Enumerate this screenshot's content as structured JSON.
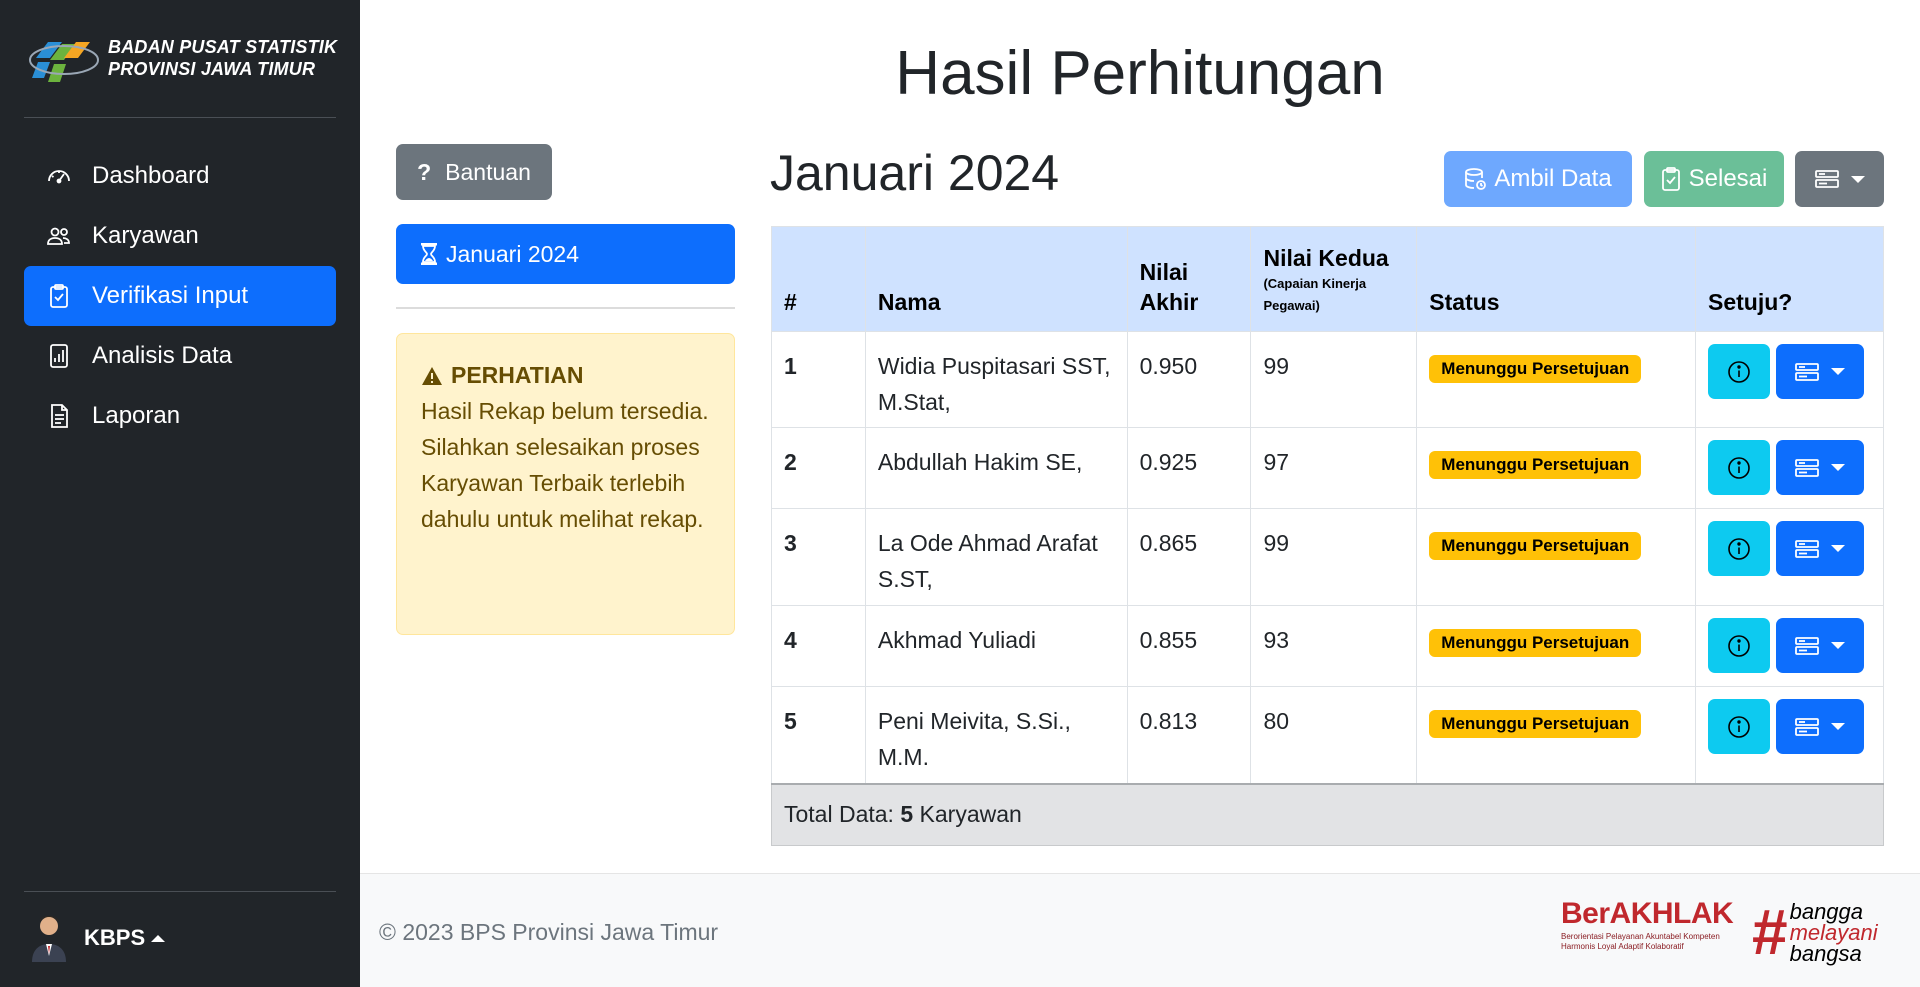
{
  "brand": {
    "line1": "BADAN PUSAT STATISTIK",
    "line2": "PROVINSI JAWA TIMUR"
  },
  "nav": [
    {
      "label": "Dashboard",
      "icon": "speedometer-icon",
      "active": false
    },
    {
      "label": "Karyawan",
      "icon": "people-icon",
      "active": false
    },
    {
      "label": "Verifikasi Input",
      "icon": "clipboard-check-icon",
      "active": true
    },
    {
      "label": "Analisis Data",
      "icon": "file-chart-icon",
      "active": false
    },
    {
      "label": "Laporan",
      "icon": "file-text-icon",
      "active": false
    }
  ],
  "user": {
    "name": "KBPS"
  },
  "page": {
    "title": "Hasil Perhitungan"
  },
  "left": {
    "help_label": "Bantuan",
    "period_label": "Januari 2024",
    "alert": {
      "title": "PERHATIAN",
      "text": "Hasil Rekap belum tersedia. Silahkan selesaikan proses Karyawan Terbaik terlebih dahulu untuk melihat rekap."
    }
  },
  "main": {
    "section_title": "Januari 2024",
    "ambil_label": "Ambil Data",
    "selesai_label": "Selesai"
  },
  "table": {
    "headers": {
      "num": "#",
      "nama": "Nama",
      "nilai_akhir": "Nilai Akhir",
      "nilai_kedua": "Nilai Kedua",
      "nilai_kedua_sub": "(Capaian Kinerja Pegawai)",
      "status": "Status",
      "setuju": "Setuju?"
    },
    "rows": [
      {
        "num": "1",
        "nama": "Widia Puspitasari SST, M.Stat,",
        "nilai_akhir": "0.950",
        "nilai_kedua": "99",
        "status": "Menunggu Persetujuan"
      },
      {
        "num": "2",
        "nama": "Abdullah Hakim SE,",
        "nilai_akhir": "0.925",
        "nilai_kedua": "97",
        "status": "Menunggu Persetujuan"
      },
      {
        "num": "3",
        "nama": "La Ode Ahmad Arafat S.ST,",
        "nilai_akhir": "0.865",
        "nilai_kedua": "99",
        "status": "Menunggu Persetujuan"
      },
      {
        "num": "4",
        "nama": "Akhmad Yuliadi",
        "nilai_akhir": "0.855",
        "nilai_kedua": "93",
        "status": "Menunggu Persetujuan"
      },
      {
        "num": "5",
        "nama": "Peni Meivita, S.Si., M.M.",
        "nilai_akhir": "0.813",
        "nilai_kedua": "80",
        "status": "Menunggu Persetujuan"
      }
    ],
    "footer": {
      "prefix": "Total Data:",
      "count": "5",
      "suffix": "Karyawan"
    }
  },
  "footer": {
    "copyright": "© 2023 BPS Provinsi Jawa Timur",
    "berakhlak_title": "BerAKHLAK",
    "berakhlak_line1": "Berorientasi Pelayanan Akuntabel Kompeten",
    "berakhlak_line2": "Harmonis Loyal Adaptif Kolaboratif",
    "bangga_hash": "#",
    "bangga_line1": "bangga",
    "bangga_line2": "melayani",
    "bangga_line3": "bangsa"
  },
  "colors": {
    "sidebar": "#212529",
    "primary": "#0d6efd",
    "info": "#0dcaf0",
    "warning": "#ffc107",
    "secondary": "#6c757d",
    "table_header": "#cfe2ff"
  }
}
